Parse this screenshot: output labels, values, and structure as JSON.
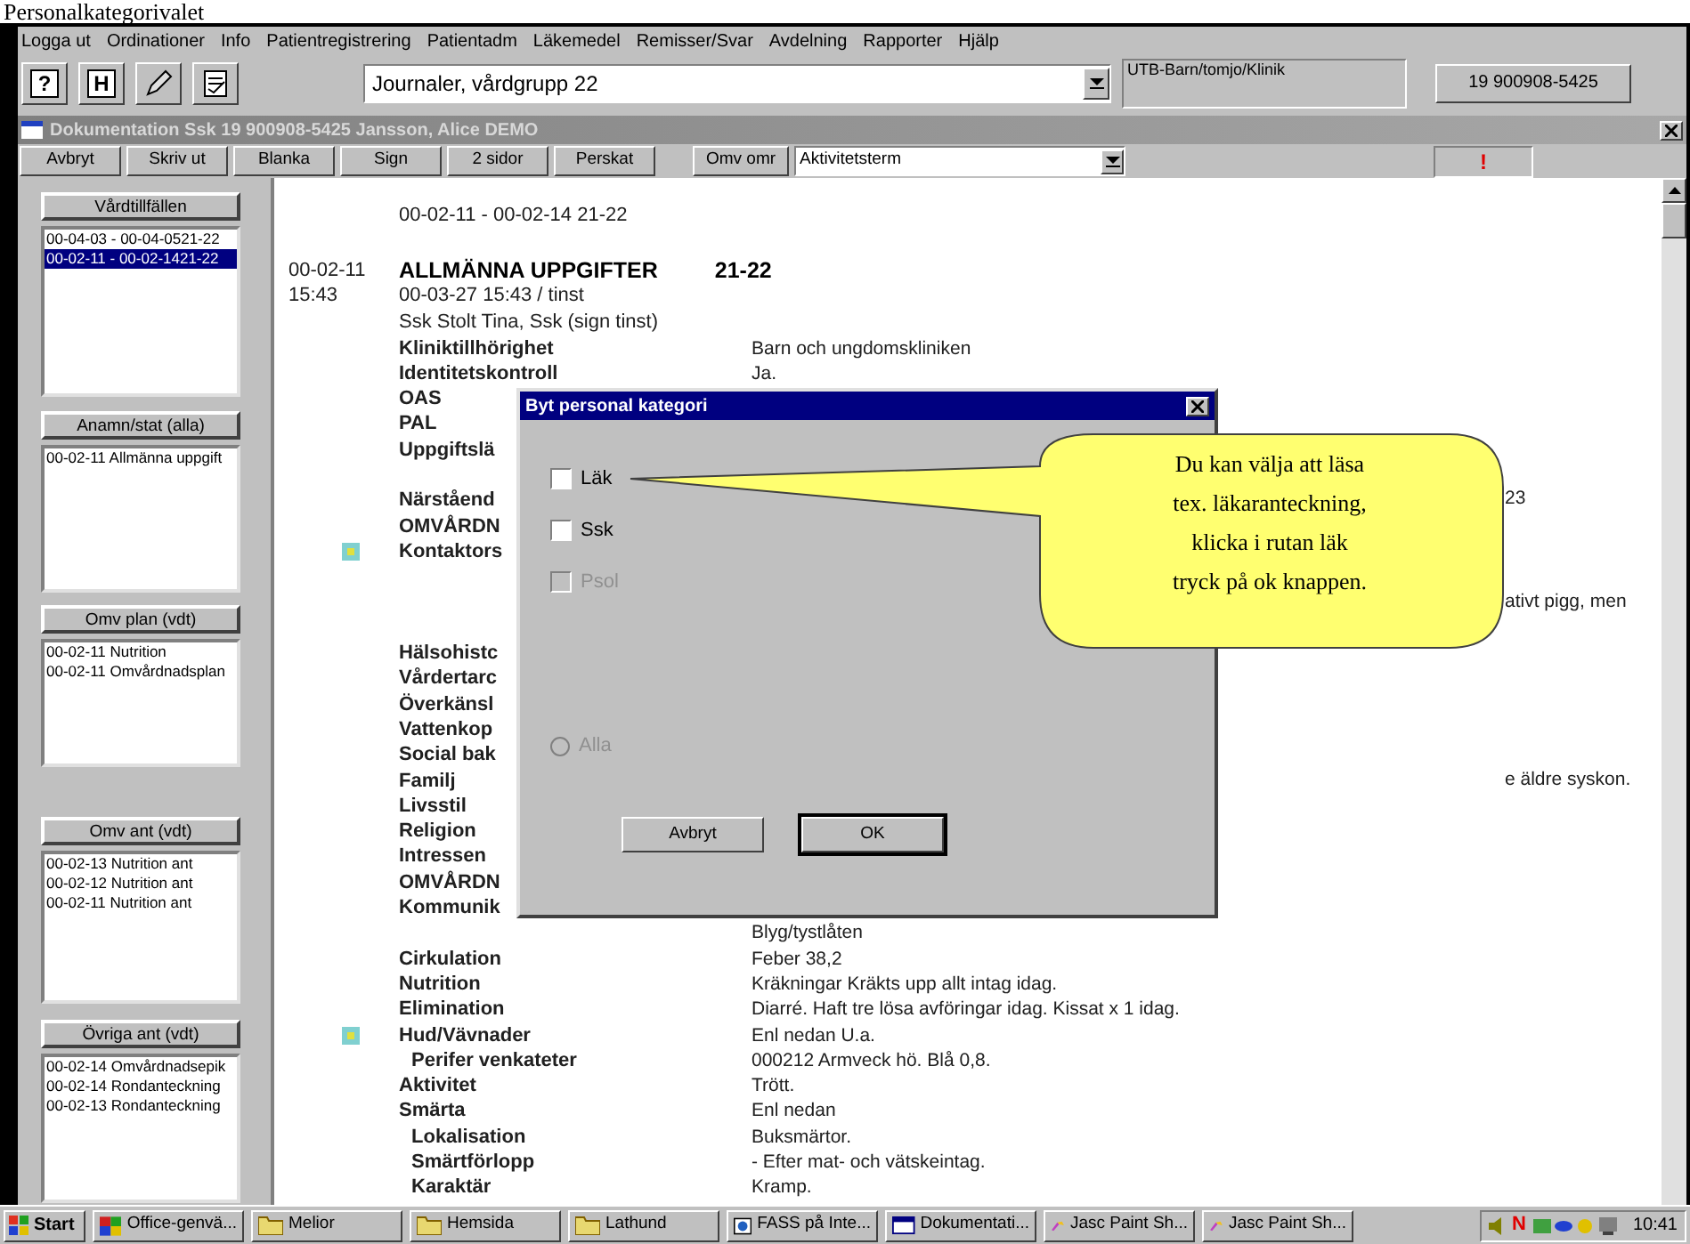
{
  "heading": "Personalkategorivalet",
  "menu": [
    "Logga ut",
    "Ordinationer",
    "Info",
    "Patientregistrering",
    "Patientadm",
    "Läkemedel",
    "Remisser/Svar",
    "Avdelning",
    "Rapporter",
    "Hjälp"
  ],
  "toolbar": {
    "icon_buttons": [
      {
        "kind": "book",
        "glyph": "?"
      },
      {
        "kind": "book",
        "glyph": "H"
      },
      {
        "kind": "pencil"
      },
      {
        "kind": "checklist"
      }
    ],
    "journal": "Journaler, vårdgrupp 22",
    "unit": "UTB-Barn/tomjo/Klinik",
    "patient_button": "19 900908-5425"
  },
  "doc_window": {
    "title": "Dokumentation Ssk 19 900908-5425 Jansson, Alice DEMO",
    "buttons": [
      "Avbryt",
      "Skriv ut",
      "Blanka",
      "Sign",
      "2 sidor",
      "Perskat"
    ],
    "area_button": "Omv omr",
    "term": "Aktivitetsterm",
    "alert": "!"
  },
  "side_sections": [
    {
      "button": "Vårdtillfällen",
      "items": [
        {
          "text": "00-04-03 - 00-04-0521-22",
          "selected": false
        },
        {
          "text": "00-02-11 - 00-02-1421-22",
          "selected": true
        }
      ]
    },
    {
      "button": "Anamn/stat (alla)",
      "items": [
        {
          "text": "00-02-11  Allmänna uppgift",
          "selected": false
        }
      ]
    },
    {
      "button": "Omv plan (vdt)",
      "items": [
        {
          "text": "00-02-11  Nutrition",
          "selected": false
        },
        {
          "text": "00-02-11  Omvårdnadsplan",
          "selected": false
        }
      ]
    },
    {
      "button": "Omv ant (vdt)",
      "items": [
        {
          "text": "00-02-13  Nutrition ant",
          "selected": false
        },
        {
          "text": "00-02-12  Nutrition ant",
          "selected": false
        },
        {
          "text": "00-02-11  Nutrition ant",
          "selected": false
        }
      ]
    },
    {
      "button": "Övriga ant (vdt)",
      "items": [
        {
          "text": "00-02-14  Omvårdnadsepik",
          "selected": false
        },
        {
          "text": "00-02-14  Rondanteckning",
          "selected": false
        },
        {
          "text": "00-02-13  Rondanteckning",
          "selected": false
        }
      ]
    }
  ],
  "journal": {
    "period": "00-02-11 - 00-02-14  21-22",
    "rows": [
      {
        "kind": "heading",
        "date": "00-02-11",
        "label": "ALLMÄNNA UPPGIFTER",
        "value": "21-22",
        "note": false
      },
      {
        "kind": "text",
        "date": "15:43",
        "label": "00-03-27 15:43 / tinst",
        "note": false
      },
      {
        "kind": "text",
        "label": "Ssk Stolt Tina, Ssk (sign tinst)",
        "note": false
      },
      {
        "kind": "label",
        "label": "Kliniktillhörighet",
        "value": "Barn och ungdomskliniken",
        "note": false
      },
      {
        "kind": "label",
        "label": "Identitetskontroll",
        "value": "Ja.",
        "note": false
      },
      {
        "kind": "label",
        "label": "OAS",
        "note": false
      },
      {
        "kind": "label",
        "label": "PAL",
        "note": false
      },
      {
        "kind": "label",
        "label": "Uppgiftslä",
        "note": false
      },
      {
        "kind": "blank",
        "note": false
      },
      {
        "kind": "label",
        "label": "Närståend",
        "tail": "23",
        "note": false
      },
      {
        "kind": "label",
        "label": "OMVÅRDN",
        "note": false
      },
      {
        "kind": "label",
        "label": "Kontaktors",
        "note": true
      },
      {
        "kind": "blank",
        "note": false
      },
      {
        "kind": "blank",
        "tail": "ativt pigg, men",
        "note": false
      },
      {
        "kind": "blank",
        "note": false
      },
      {
        "kind": "label",
        "label": "Hälsohistc",
        "note": false
      },
      {
        "kind": "label",
        "label": "Vårdertarc",
        "note": false
      },
      {
        "kind": "label",
        "label": "Överkänsl",
        "note": false
      },
      {
        "kind": "label",
        "label": "Vattenkop",
        "note": false
      },
      {
        "kind": "label",
        "label": "Social bak",
        "note": false
      },
      {
        "kind": "label",
        "label": "Familj",
        "tail": "e äldre syskon.",
        "note": false
      },
      {
        "kind": "label",
        "label": "Livsstil",
        "note": false
      },
      {
        "kind": "label",
        "label": "Religion",
        "note": false
      },
      {
        "kind": "label",
        "label": "Intressen",
        "note": false
      },
      {
        "kind": "label",
        "label": "OMVÅRDN",
        "note": false
      },
      {
        "kind": "label",
        "label": "Kommunik",
        "note": false
      },
      {
        "kind": "label",
        "label": "",
        "value": "Blyg/tystlåten",
        "note": false
      },
      {
        "kind": "label",
        "label": "Cirkulation",
        "value": "Feber 38,2",
        "note": false
      },
      {
        "kind": "label",
        "label": "Nutrition",
        "value": "Kräkningar Kräkts upp allt intag idag.",
        "note": false
      },
      {
        "kind": "label",
        "label": "Elimination",
        "value": "Diarré. Haft tre lösa avföringar idag. Kissat x 1 idag.",
        "note": false
      },
      {
        "kind": "label",
        "label": "Hud/Vävnader",
        "value": "Enl nedan U.a.",
        "note": true
      },
      {
        "kind": "sub",
        "label": "Perifer venkateter",
        "value": "000212 Armveck hö.  Blå 0,8.",
        "note": false
      },
      {
        "kind": "label",
        "label": "Aktivitet",
        "value": "Trött.",
        "note": false
      },
      {
        "kind": "label",
        "label": "Smärta",
        "value": "Enl nedan",
        "note": false
      },
      {
        "kind": "sub",
        "label": "Lokalisation",
        "value": "Buksmärtor.",
        "note": false
      },
      {
        "kind": "sub",
        "label": "Smärtförlopp",
        "value": "- Efter mat- och vätskeintag.",
        "note": false
      },
      {
        "kind": "sub",
        "label": "Karaktär",
        "value": "Kramp.",
        "note": false
      }
    ]
  },
  "dialog": {
    "title": "Byt personal kategori",
    "options": [
      {
        "label": "Läk",
        "checked": false,
        "disabled": false
      },
      {
        "label": "Ssk",
        "checked": false,
        "disabled": false
      },
      {
        "label": "Psol",
        "checked": false,
        "disabled": true
      }
    ],
    "all": {
      "label": "Alla",
      "selected": false,
      "disabled": true
    },
    "buttons": [
      {
        "label": "Avbryt",
        "focused": false
      },
      {
        "label": "OK",
        "focused": true
      }
    ]
  },
  "callout": {
    "lines": [
      "Du kan välja att läsa",
      "tex. läkaranteckning,",
      "klicka i rutan läk",
      "tryck på ok knappen."
    ]
  },
  "taskbar": {
    "start": "Start",
    "tasks": [
      {
        "kind": "office",
        "label": "Office-genvä..."
      },
      {
        "kind": "folder",
        "label": "Melior"
      },
      {
        "kind": "folder",
        "label": "Hemsida"
      },
      {
        "kind": "folder",
        "label": "Lathund"
      },
      {
        "kind": "browser",
        "label": "FASS på Inte..."
      },
      {
        "kind": "window",
        "label": "Dokumentati..."
      },
      {
        "kind": "paint",
        "label": "Jasc Paint Sh..."
      },
      {
        "kind": "paint",
        "label": "Jasc Paint Sh..."
      }
    ],
    "tray_letter": "N",
    "clock": "10:41"
  }
}
